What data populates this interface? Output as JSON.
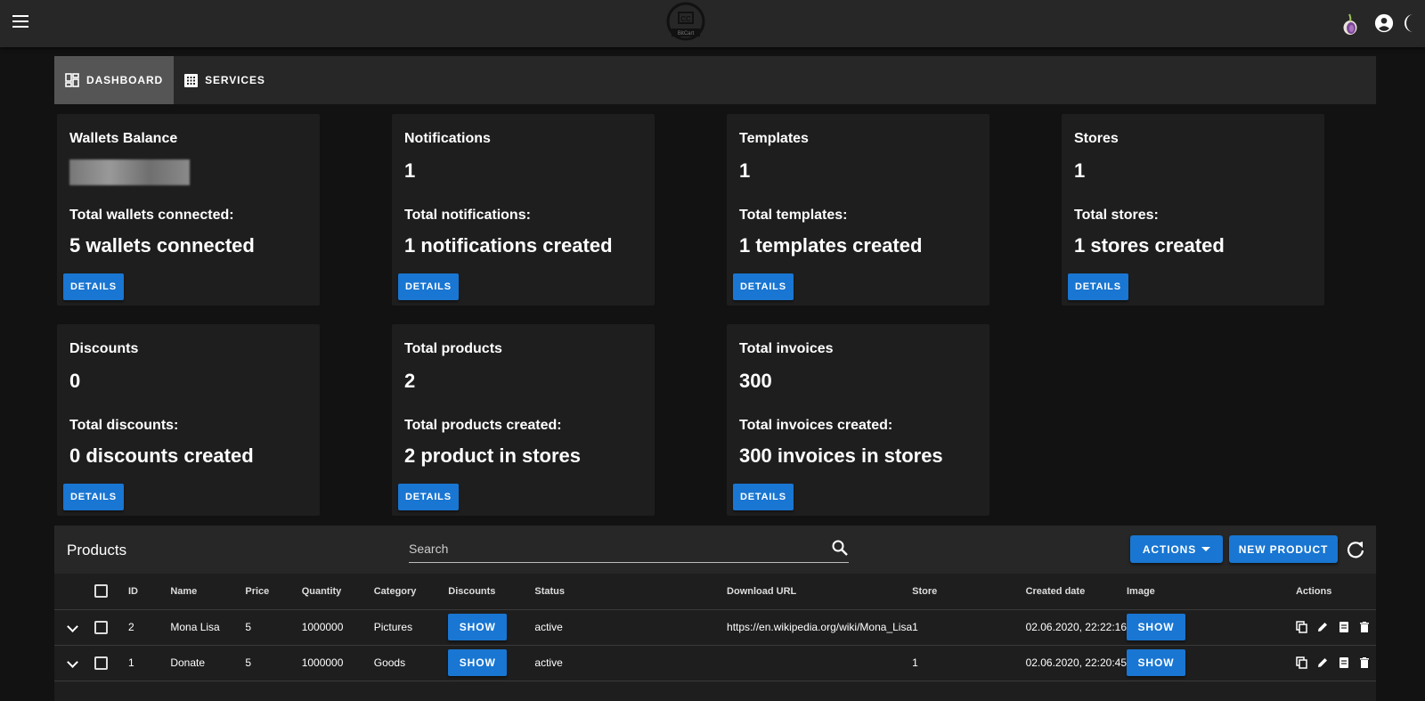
{
  "appbar": {
    "logo_text": "CC BitCart",
    "icons": [
      "menu-icon",
      "tor-onion-icon",
      "account-circle-icon",
      "dark-mode-moon-icon"
    ]
  },
  "tabs": [
    {
      "label": "DASHBOARD",
      "icon": "dashboard-icon",
      "active": true
    },
    {
      "label": "SERVICES",
      "icon": "services-grid-icon",
      "active": false
    }
  ],
  "cards": [
    {
      "title": "Wallets Balance",
      "value": "",
      "value_blurred": true,
      "sub": "Total wallets connected:",
      "big": "5 wallets connected",
      "button": "DETAILS"
    },
    {
      "title": "Notifications",
      "value": "1",
      "sub": "Total notifications:",
      "big": "1 notifications created",
      "button": "DETAILS"
    },
    {
      "title": "Templates",
      "value": "1",
      "sub": "Total templates:",
      "big": "1 templates created",
      "button": "DETAILS"
    },
    {
      "title": "Stores",
      "value": "1",
      "sub": "Total stores:",
      "big": "1 stores created",
      "button": "DETAILS"
    },
    {
      "title": "Discounts",
      "value": "0",
      "sub": "Total discounts:",
      "big": "0 discounts created",
      "button": "DETAILS"
    },
    {
      "title": "Total products",
      "value": "2",
      "sub": "Total products created:",
      "big": "2 product in stores",
      "button": "DETAILS"
    },
    {
      "title": "Total invoices",
      "value": "300",
      "sub": "Total invoices created:",
      "big": "300 invoices in stores",
      "button": "DETAILS"
    }
  ],
  "products": {
    "title": "Products",
    "search_placeholder": "Search",
    "search_value": "",
    "actions_label": "ACTIONS",
    "new_product_label": "NEW PRODUCT",
    "columns": [
      "ID",
      "Name",
      "Price",
      "Quantity",
      "Category",
      "Discounts",
      "Status",
      "Download URL",
      "Store",
      "Created date",
      "Image",
      "Actions"
    ],
    "show_label": "SHOW",
    "rows": [
      {
        "id": "2",
        "name": "Mona Lisa",
        "price": "5",
        "quantity": "1000000",
        "category": "Pictures",
        "status": "active",
        "download_url": "https://en.wikipedia.org/wiki/Mona_Lisa",
        "store": "1",
        "created": "02.06.2020, 22:22:16"
      },
      {
        "id": "1",
        "name": "Donate",
        "price": "5",
        "quantity": "1000000",
        "category": "Goods",
        "status": "active",
        "download_url": "",
        "store": "1",
        "created": "02.06.2020, 22:20:45"
      }
    ],
    "row_action_icons": [
      "copy-icon",
      "edit-pencil-icon",
      "details-icon",
      "delete-icon"
    ]
  },
  "colors": {
    "background": "#121212",
    "appbar": "#272727",
    "card": "#1e1e1e",
    "primary_button": "#1976d2",
    "active_tab": "#555555"
  }
}
